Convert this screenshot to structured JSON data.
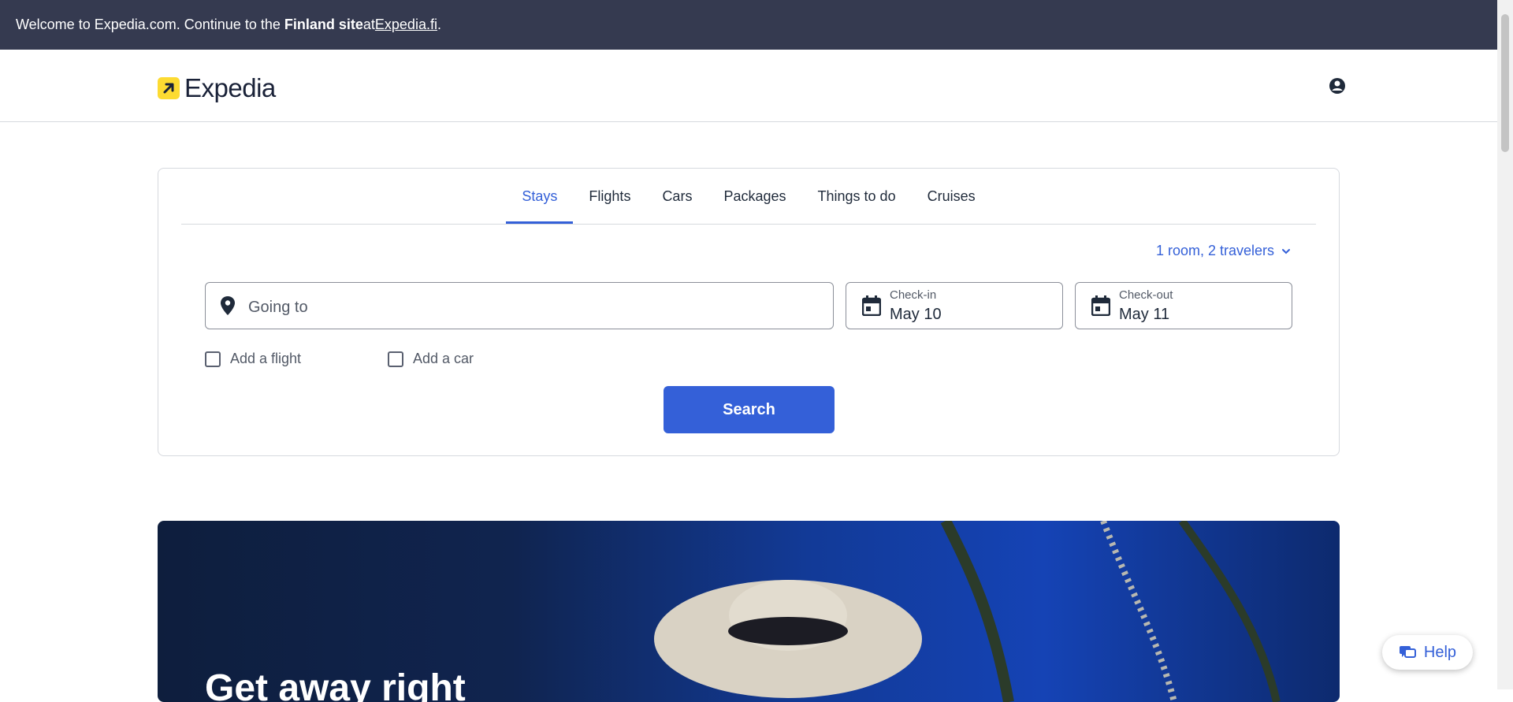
{
  "banner": {
    "prefix": "Welcome to Expedia.com. Continue to the ",
    "site": "Finland site",
    "middle": " at ",
    "link": "Expedia.fi",
    "suffix": "."
  },
  "header": {
    "logo_text": "Expedia",
    "account_icon": "account-icon"
  },
  "tabs": [
    {
      "label": "Stays",
      "active": true
    },
    {
      "label": "Flights"
    },
    {
      "label": "Cars"
    },
    {
      "label": "Packages"
    },
    {
      "label": "Things to do"
    },
    {
      "label": "Cruises"
    }
  ],
  "search": {
    "travelers": "1 room, 2 travelers",
    "going_to_placeholder": "Going to",
    "checkin_label": "Check-in",
    "checkin_value": "May 10",
    "checkout_label": "Check-out",
    "checkout_value": "May 11",
    "add_flight": "Add a flight",
    "add_car": "Add a car",
    "button": "Search"
  },
  "hero": {
    "title": "Get away right"
  },
  "help": {
    "label": "Help"
  },
  "colors": {
    "brand_blue": "#3460d8",
    "banner_bg": "#353a50",
    "logo_yellow": "#fddb32"
  }
}
